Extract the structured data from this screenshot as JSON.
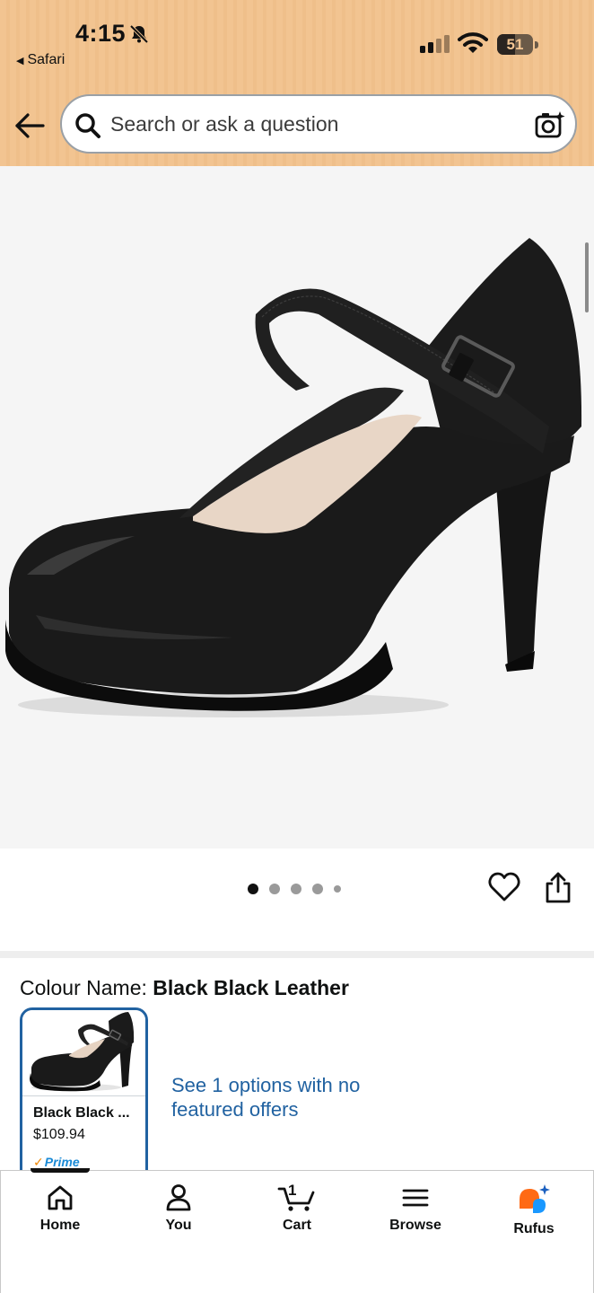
{
  "status_bar": {
    "time": "4:15",
    "back_app": "Safari",
    "battery_level": "51",
    "icons": [
      "bell-slash-icon",
      "cellular-signal-icon",
      "wifi-icon",
      "battery-icon"
    ]
  },
  "header": {
    "search_placeholder": "Search or ask a question",
    "icons": [
      "back-arrow-icon",
      "search-icon",
      "camera-search-icon"
    ]
  },
  "gallery": {
    "image_count": 5,
    "active_index": 0,
    "icons": [
      "heart-icon",
      "share-icon"
    ]
  },
  "colour": {
    "label": "Colour Name: ",
    "value": "Black Black Leather"
  },
  "swatch": {
    "title": "Black Black ...",
    "price": "$109.94",
    "prime_check": "✓",
    "prime_label": "Prime"
  },
  "options_link": "See 1 options with no featured offers",
  "tab_bar": {
    "items": [
      {
        "label": "Home",
        "icon": "home-icon"
      },
      {
        "label": "You",
        "icon": "person-icon"
      },
      {
        "label": "Cart",
        "icon": "cart-icon",
        "count": "1"
      },
      {
        "label": "Browse",
        "icon": "menu-icon"
      },
      {
        "label": "Rufus",
        "icon": "rufus-icon"
      }
    ]
  },
  "colors": {
    "header_bg": "#f2c491",
    "link": "#2162a1",
    "prime": "#1a8ad6",
    "rufus_orange": "#ff6a14",
    "rufus_blue": "#1a98ff"
  }
}
